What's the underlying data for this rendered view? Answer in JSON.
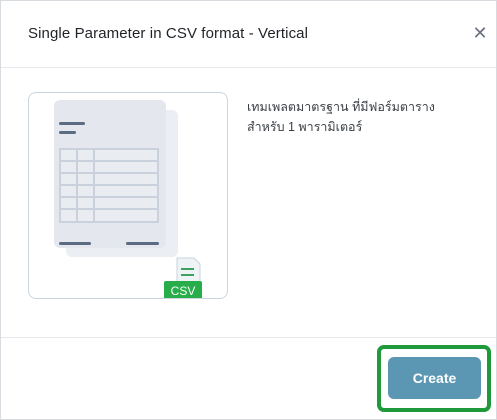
{
  "dialog": {
    "title": "Single Parameter in CSV format - Vertical",
    "close_icon": "close-icon",
    "description": "เทมเพลตมาตรฐาน ที่มีฟอร์มตารางสำหรับ 1 พารามิเตอร์",
    "thumbnail_badge": "CSV",
    "create_label": "Create"
  },
  "colors": {
    "primary_button": "#5b97b3",
    "highlight": "#1f9a3b",
    "csv_badge": "#27ae4a",
    "table_fill": "#dde3ea",
    "accent_line": "#5b6b82"
  }
}
